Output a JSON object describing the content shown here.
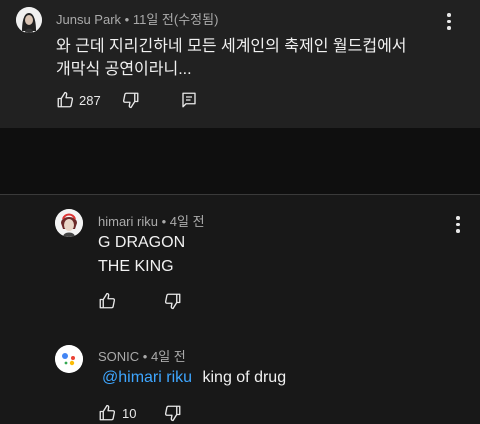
{
  "comments": [
    {
      "author": "Junsu Park",
      "sep": "•",
      "time": "11일 전(수정됨)",
      "lines": [
        "와 근데 지리긴하네 모든 세계인의 축제인 월드컵에서",
        "개막식 공연이라니..."
      ],
      "likes": "287"
    },
    {
      "author": "himari riku",
      "sep": "•",
      "time": "4일 전",
      "lines": [
        "G DRAGON",
        "THE KING"
      ],
      "likes": ""
    },
    {
      "author": "SONIC",
      "sep": "•",
      "time": "4일 전",
      "mention": "@himari riku",
      "text": "king of drug",
      "likes": "10"
    }
  ],
  "colors": {
    "mention": "#3ea6ff",
    "background": "#0f0f0f",
    "card": "#212121"
  },
  "icons": [
    "like-icon",
    "dislike-icon",
    "reply-icon",
    "more-vert-icon"
  ]
}
